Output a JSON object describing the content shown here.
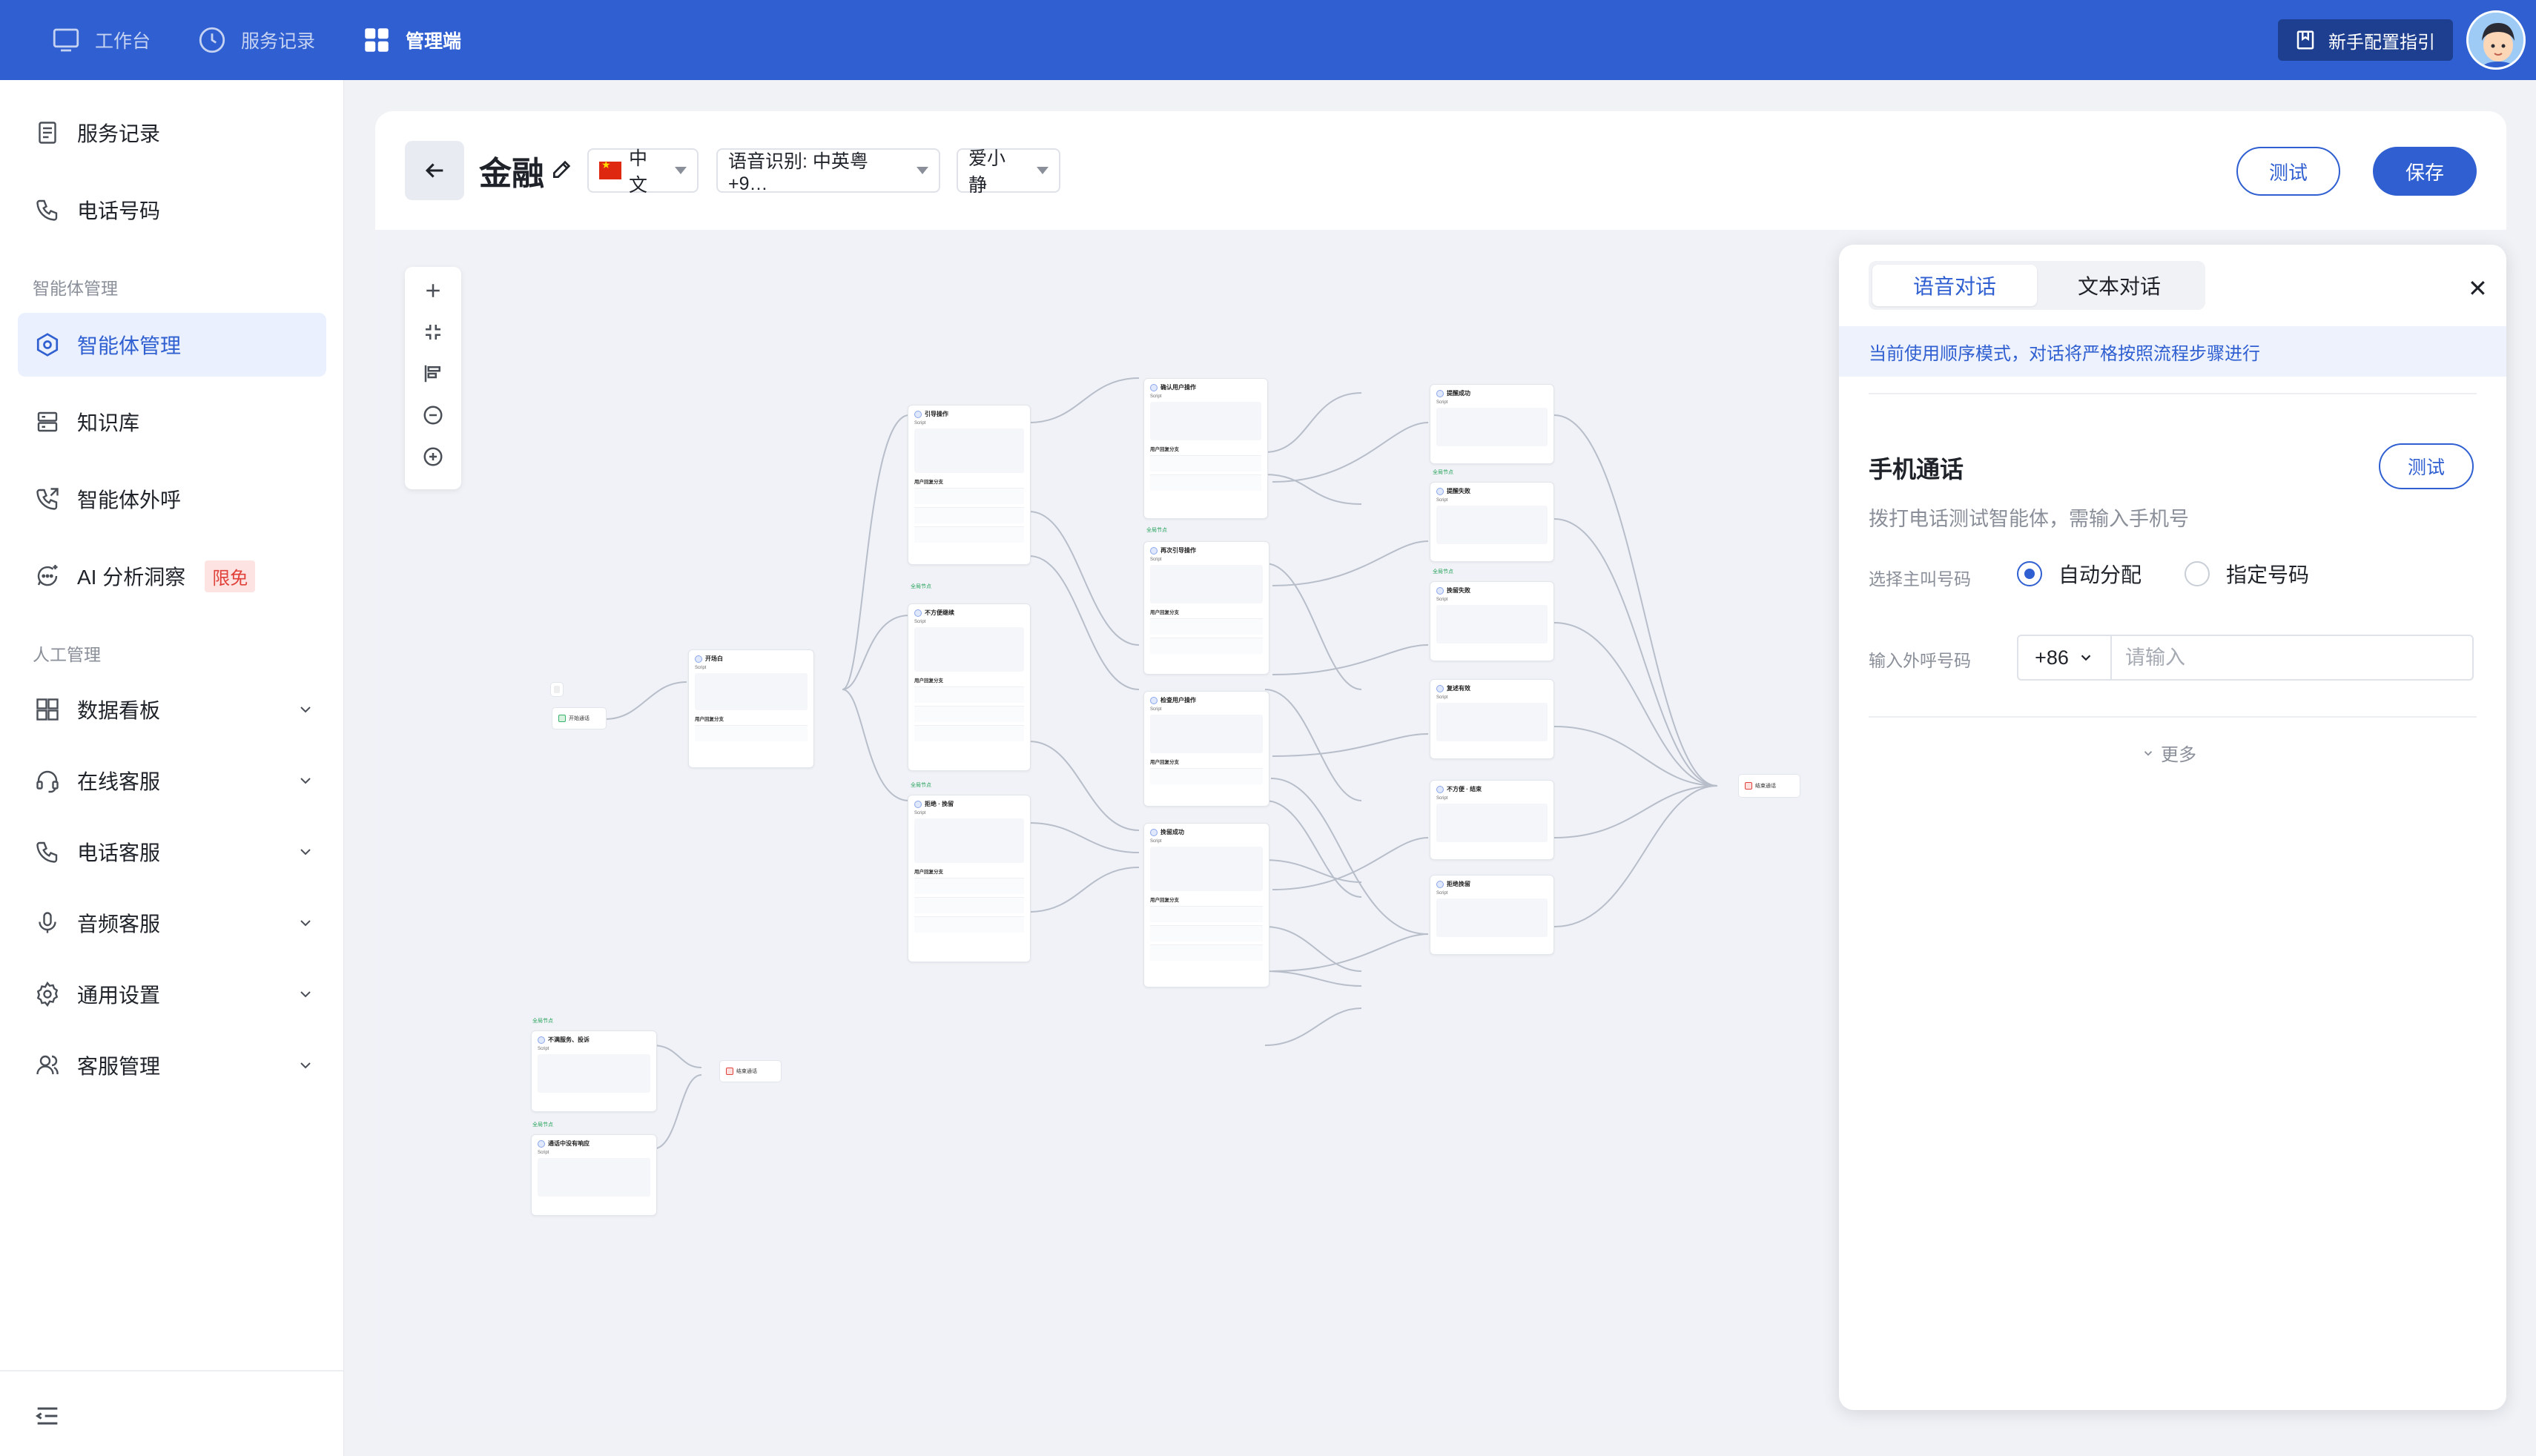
{
  "topnav": {
    "items": [
      {
        "label": "工作台",
        "icon": "monitor-icon"
      },
      {
        "label": "服务记录",
        "icon": "clock-icon"
      },
      {
        "label": "管理端",
        "icon": "grid-icon",
        "active": true
      }
    ],
    "guide_label": "新手配置指引"
  },
  "sidebar": {
    "items_top": [
      {
        "label": "服务记录",
        "icon": "document-icon"
      },
      {
        "label": "电话号码",
        "icon": "phone-icon"
      }
    ],
    "section_agent": "智能体管理",
    "items_agent": [
      {
        "label": "智能体管理",
        "icon": "hexagon-icon",
        "active": true
      },
      {
        "label": "知识库",
        "icon": "database-icon"
      },
      {
        "label": "智能体外呼",
        "icon": "phone-out-icon"
      },
      {
        "label": "AI 分析洞察",
        "icon": "chat-spark-icon",
        "badge": "限免"
      }
    ],
    "section_human": "人工管理",
    "items_human": [
      {
        "label": "数据看板",
        "icon": "dashboard-icon"
      },
      {
        "label": "在线客服",
        "icon": "headset-icon"
      },
      {
        "label": "电话客服",
        "icon": "phone-icon"
      },
      {
        "label": "音频客服",
        "icon": "mic-icon"
      },
      {
        "label": "通用设置",
        "icon": "gear-icon"
      },
      {
        "label": "客服管理",
        "icon": "users-icon"
      }
    ]
  },
  "header": {
    "title": "金融",
    "language": "中文",
    "asr": "语音识别: 中英粤+9…",
    "voice": "爱小静",
    "test_label": "测试",
    "save_label": "保存"
  },
  "flow": {
    "start": "开始通话",
    "open": "开场白",
    "end": "结束通话",
    "script": "Script",
    "branch": "用户回复分支",
    "tag": "全局节点",
    "nodes": {
      "n1": "引导操作",
      "n2": "不方便继续",
      "n3": "拒绝 · 挽留",
      "n4": "确认用户操作",
      "n5": "再次引导操作",
      "n6": "检查用户操作",
      "n7": "挽留成功",
      "n8": "提醒成功",
      "n9": "提醒失败",
      "n10": "挽留失败",
      "n11": "复述有效",
      "n12": "不方便 · 结束",
      "n13": "拒绝挽留",
      "g1": "不满服务、投诉",
      "g2": "通话中没有响应"
    }
  },
  "panel": {
    "tabs": [
      "语音对话",
      "文本对话"
    ],
    "notice": "当前使用顺序模式，对话将严格按照流程步骤进行",
    "section_title": "手机通话",
    "test_label": "测试",
    "desc": "拨打电话测试智能体，需输入手机号",
    "caller_label": "选择主叫号码",
    "radio_auto": "自动分配",
    "radio_assign": "指定号码",
    "callee_label": "输入外呼号码",
    "country_code": "+86",
    "phone_placeholder": "请输入",
    "more_label": "更多"
  }
}
